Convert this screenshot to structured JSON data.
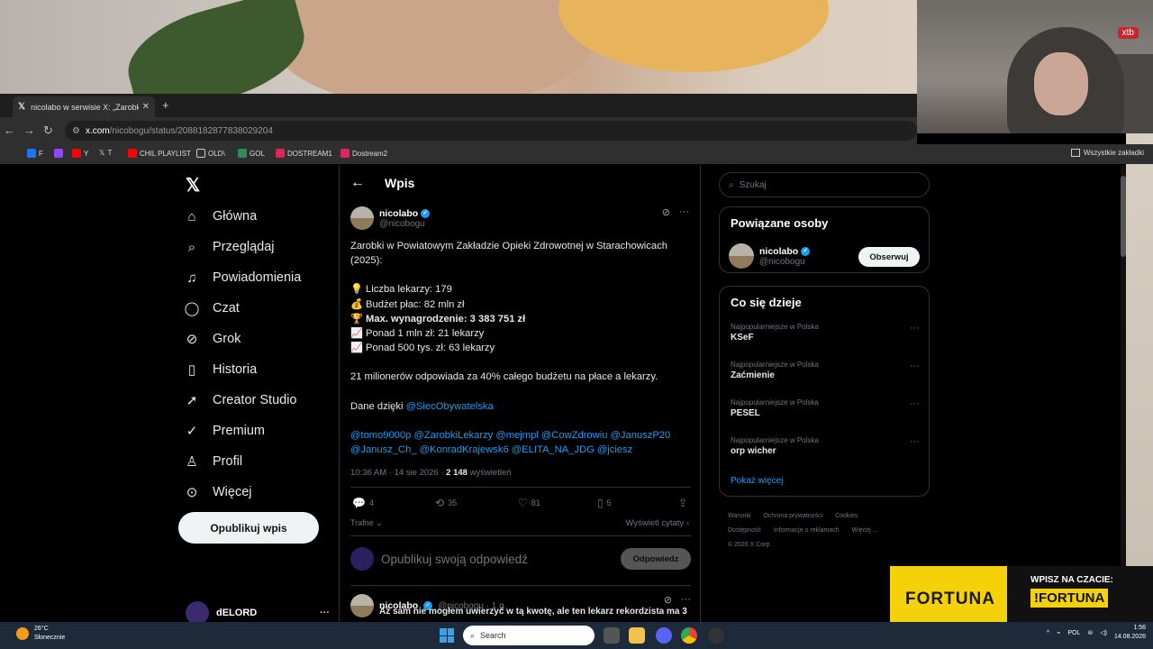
{
  "browser": {
    "tab_title": "nicolabo w serwisie X: „Zarobki",
    "url_host": "x.com",
    "url_path": "/nicobogu/status/2088182877838029204",
    "bookmarks": [
      "F",
      "",
      "Y",
      "T",
      "CHIL PLAYLIST",
      "OLD\\",
      "GOL",
      "DOSTREAM1",
      "Dostream2"
    ],
    "all_bookmarks": "Wszystkie zakładki"
  },
  "overlay": {
    "xtb": "xtb",
    "fortuna_logo": "FORTUNA",
    "fortuna_cta": "WPISZ NA CZACIE:",
    "fortuna_cmd": "!FORTUNA"
  },
  "nav": {
    "items": [
      "Główna",
      "Przeglądaj",
      "Powiadomienia",
      "Czat",
      "Grok",
      "Historia",
      "Creator Studio",
      "Premium",
      "Profil",
      "Więcej"
    ],
    "publish": "Opublikuj wpis",
    "account_name": "dELORD"
  },
  "post": {
    "header": "Wpis",
    "author_name": "nicolabo",
    "author_handle": "@nicobogu",
    "line1": "Zarobki w Powiatowym Zakładzie Opieki Zdrowotnej w Starachowicach (2025):",
    "stats": [
      {
        "emoji": "💡",
        "text": "Liczba lekarzy: 179",
        "bold": false
      },
      {
        "emoji": "💰",
        "text": "Budżet płac: 82 mln zł",
        "bold": false
      },
      {
        "emoji": "🏆",
        "text": "Max. wynagrodzenie: 3 383 751 zł",
        "bold": true
      },
      {
        "emoji": "📈",
        "text": "Ponad 1 mln zł: 21 lekarzy",
        "bold": false
      },
      {
        "emoji": "📈",
        "text": "Ponad 500 tys. zł: 63 lekarzy",
        "bold": false
      }
    ],
    "summary": "21 milionerów odpowiada za 40% całego budżetu na płace a lekarzy.",
    "thanks_prefix": "Dane dzięki ",
    "thanks_link": "@SiecObywatelska",
    "mentions_line1": "@tomo9000p @ZarobkiLekarzy @mejmpl @CowZdrowiu @JanuszP20",
    "mentions_line2": "@Janusz_Ch_ @KonradKrajewsk6 @ELITA_NA_JDG @jciesz",
    "time": "10:36 AM · 14 sie 2026 · ",
    "views": "2 148",
    "views_label": " wyświetleń",
    "replies": "4",
    "reposts": "35",
    "likes": "81",
    "bookmarks": "5",
    "sort_label": "Trafne",
    "quotes_label": "Wyświetl cytaty",
    "reply_placeholder": "Opublikuj swoją odpowiedź",
    "reply_button": "Odpowiedz"
  },
  "reply": {
    "author_name": "nicolabo",
    "author_handle": "@nicobogu · 1 g.",
    "text": "Aż sam nie mogłem uwierzyć w tą kwotę, ale ten lekarz rekordzista ma 3"
  },
  "sidebar": {
    "search_placeholder": "Szukaj",
    "related_title": "Powiązane osoby",
    "related_name": "nicolabo",
    "related_handle": "@nicobogu",
    "follow": "Obserwuj",
    "trends_title": "Co się dzieje",
    "trends": [
      {
        "category": "Najpopularniejsze w Polska",
        "name": "KSeF"
      },
      {
        "category": "Najpopularniejsze w Polska",
        "name": "Zaćmienie"
      },
      {
        "category": "Najpopularniejsze w Polska",
        "name": "PESEL"
      },
      {
        "category": "Najpopularniejsze w Polska",
        "name": "orp wicher"
      }
    ],
    "show_more": "Pokaż więcej",
    "footer": [
      "Warunki",
      "Ochrona prywatności",
      "Cookies",
      "Dostępność",
      "Informacje o reklamach",
      "Więcej ...",
      "© 2026 X Corp."
    ]
  },
  "taskbar": {
    "temp": "26°C",
    "weather": "Słonecznie",
    "search": "Search",
    "lang": "POL",
    "time": "1:56",
    "date": "14.08.2026"
  },
  "colors": {
    "accent": "#1d9bf0",
    "background": "#000000",
    "border": "#2f3336",
    "fortuna": "#f5d10a"
  }
}
